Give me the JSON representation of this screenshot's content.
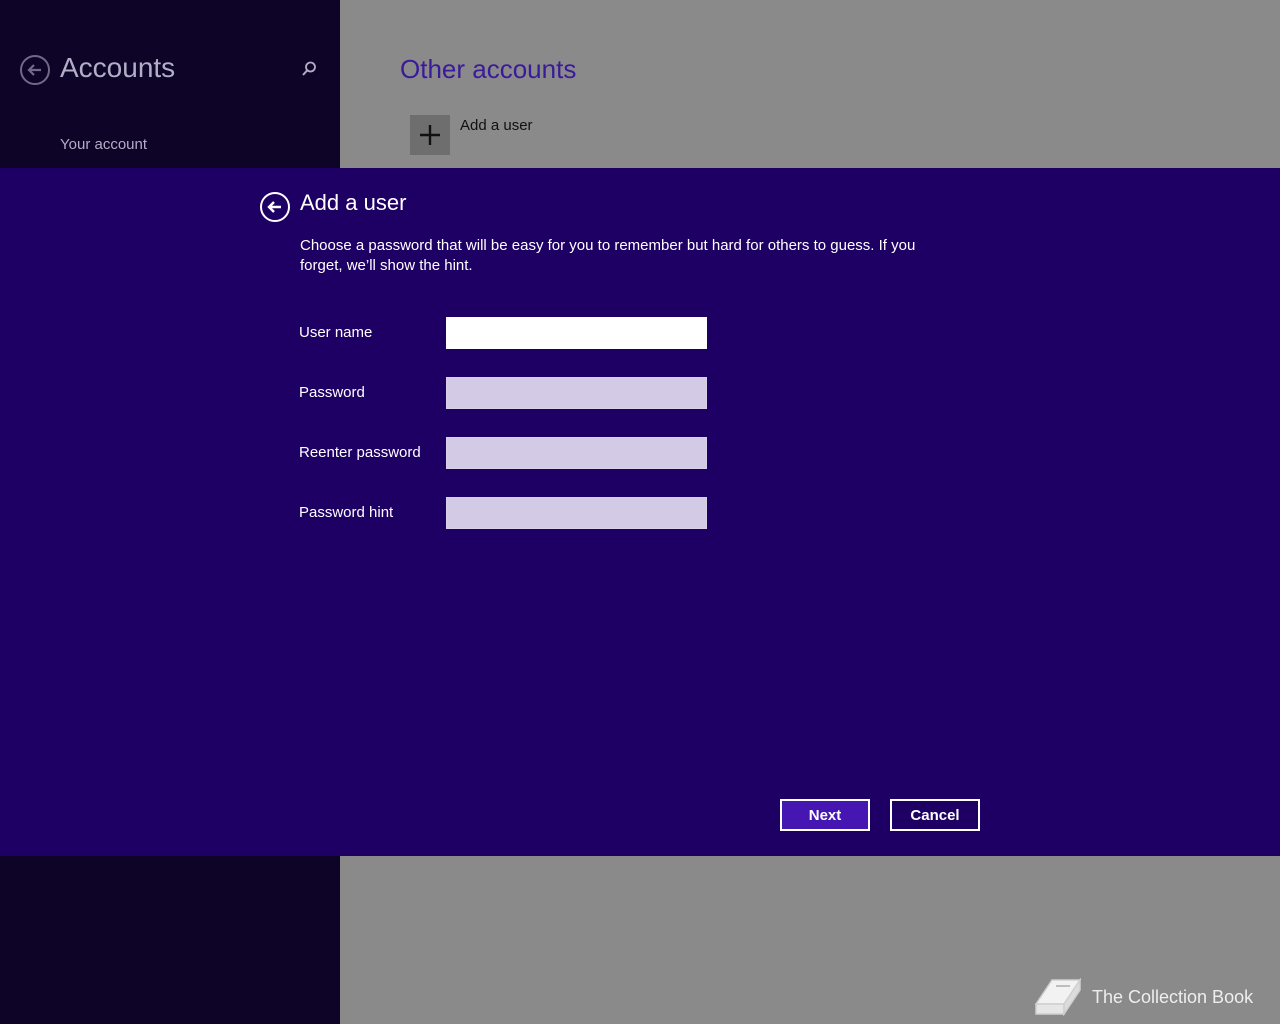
{
  "background": {
    "left": {
      "title": "Accounts",
      "back_icon": "back-arrow-icon",
      "search_icon": "search-icon",
      "nav_item": "Your account"
    },
    "right": {
      "title": "Other accounts",
      "add_tile_icon": "plus-icon",
      "add_user_label": "Add a user"
    }
  },
  "dialog": {
    "title": "Add a user",
    "description": "Choose a password that will be easy for you to remember but hard for others to guess. If you forget, we’ll show the hint.",
    "fields": [
      {
        "label": "User name",
        "value": ""
      },
      {
        "label": "Password",
        "value": ""
      },
      {
        "label": "Reenter password",
        "value": ""
      },
      {
        "label": "Password hint",
        "value": ""
      }
    ],
    "buttons": {
      "next": "Next",
      "cancel": "Cancel"
    }
  },
  "watermark": {
    "text": "The Collection Book",
    "icon": "book-icon"
  },
  "colors": {
    "modal_bg": "#1e0064",
    "accent": "#4616b3",
    "left_pane": "#0d0427",
    "right_pane": "#8a8a8a"
  }
}
